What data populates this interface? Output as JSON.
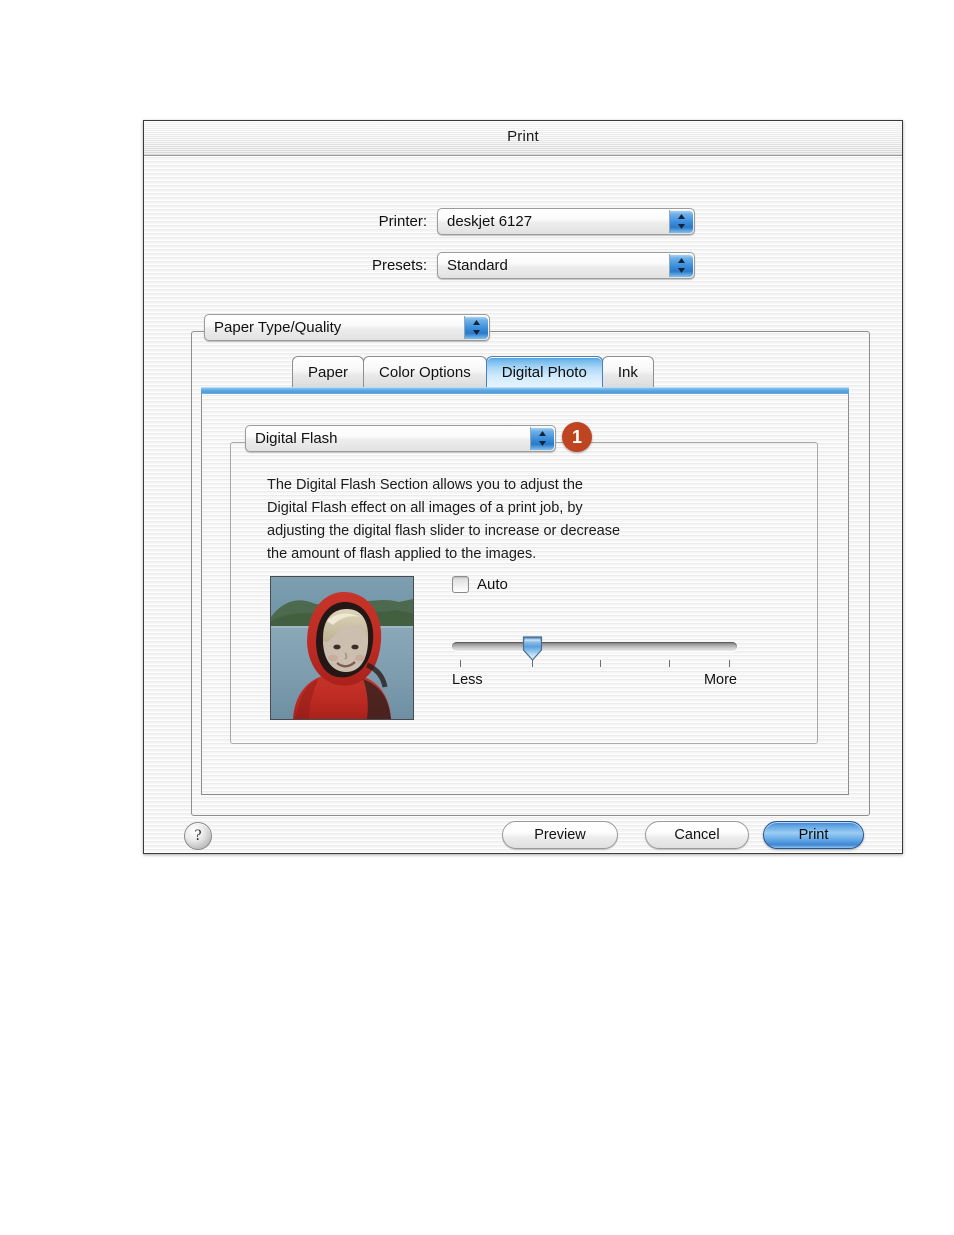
{
  "window": {
    "title": "Print"
  },
  "fields": {
    "printer_label": "Printer:",
    "printer_value": "deskjet 6127",
    "presets_label": "Presets:",
    "presets_value": "Standard"
  },
  "pane_popup": {
    "value": "Paper Type/Quality"
  },
  "tabs": [
    {
      "label": "Paper",
      "active": false
    },
    {
      "label": "Color Options",
      "active": false
    },
    {
      "label": "Digital Photo",
      "active": true
    },
    {
      "label": "Ink",
      "active": false
    }
  ],
  "section": {
    "popup_value": "Digital Flash",
    "callout_number": "1",
    "callout_color": "#bf4520",
    "description": "The Digital Flash Section allows you to adjust the Digital Flash effect on all images of a print job, by adjusting the digital flash slider to increase or decrease the amount of flash applied to the images.",
    "description_lines": [
      "The Digital Flash Section allows you to adjust the",
      "Digital Flash effect on all images of a print job, by",
      "adjusting the digital flash slider to increase or decrease",
      "the amount of flash applied to the images."
    ]
  },
  "auto": {
    "label": "Auto",
    "checked": false
  },
  "slider": {
    "min_label": "Less",
    "max_label": "More",
    "value_percent": 28,
    "tick_percents": [
      3,
      28,
      52,
      76,
      97
    ]
  },
  "preview_image": {
    "alt": "child in red hooded jacket by a lake"
  },
  "buttons": {
    "help": "?",
    "preview": "Preview",
    "cancel": "Cancel",
    "print": "Print"
  },
  "colors": {
    "accent_blue": "#3b8fdc",
    "tab_active": "#a8d6f6",
    "callout": "#bf4520"
  }
}
